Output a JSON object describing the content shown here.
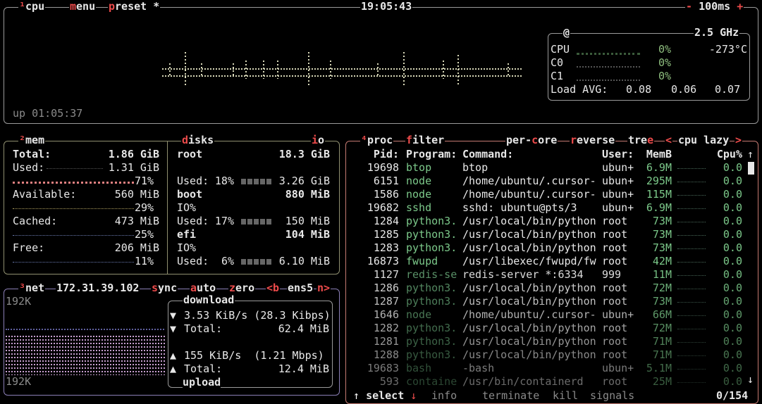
{
  "cpu": {
    "title": "cpu",
    "menu": "menu",
    "preset": "preset *",
    "clock": "19:05:43",
    "interval_minus": "-",
    "interval": "100ms",
    "interval_plus": "+",
    "uptime": "up 01:05:37",
    "freq_at": "@",
    "freq": "2.5 GHz",
    "rows": [
      {
        "label": "CPU",
        "pct": "0%",
        "temp": "-273°C"
      },
      {
        "label": "C0",
        "pct": "0%",
        "temp": ""
      },
      {
        "label": "C1",
        "pct": "0%",
        "temp": ""
      }
    ],
    "load_label": "Load AVG:",
    "load": [
      "0.08",
      "0.06",
      "0.07"
    ]
  },
  "mem": {
    "title": "mem",
    "total_label": "Total:",
    "total": "1.86 GiB",
    "used_label": "Used:",
    "used": "1.31 GiB",
    "used_pct": "71%",
    "avail_label": "Available:",
    "avail": "560 MiB",
    "avail_pct": "29%",
    "cached_label": "Cached:",
    "cached": "473 MiB",
    "cached_pct": "25%",
    "free_label": "Free:",
    "free": "206 MiB",
    "free_pct": "11%"
  },
  "disks": {
    "title": "disks",
    "io_tab": "io",
    "items": [
      {
        "name": "root",
        "size": "18.3 GiB",
        "io": "",
        "used_label": "Used:",
        "used_pct": "18%",
        "used": "3.26 GiB"
      },
      {
        "name": "boot",
        "size": "880 MiB",
        "io": "IO%",
        "used_label": "Used:",
        "used_pct": "17%",
        "used": "150 MiB"
      },
      {
        "name": "efi",
        "size": "104 MiB",
        "io": "IO%",
        "used_label": "Used:",
        "used_pct": "6%",
        "used": "6.10 MiB"
      }
    ]
  },
  "net": {
    "title": "net",
    "ip": "172.31.39.102",
    "sync": "sync",
    "auto": "auto",
    "zero": "zero",
    "prev": "<b",
    "iface": "ens5",
    "next": "n>",
    "scale_top": "192K",
    "scale_bottom": "192K",
    "download_label": "download",
    "down_rate": "3.53 KiB/s (28.3 Kibps)",
    "down_total_label": "Total:",
    "down_total": "62.4 MiB",
    "up_rate": "155 KiB/s  (1.21 Mbps)",
    "up_total_label": "Total:",
    "up_total": "12.4 MiB",
    "upload_label": "upload"
  },
  "proc": {
    "title": "proc",
    "filter": "filter",
    "per_core": "per-core",
    "reverse": "reverse",
    "tree": "tree",
    "sort": "cpu lazy",
    "sort_prev": "<",
    "sort_next": ">",
    "headers": {
      "pid": "Pid:",
      "program": "Program:",
      "command": "Command:",
      "user": "User:",
      "mem": "MemB",
      "cpu": "Cpu%"
    },
    "rows": [
      {
        "pid": "19698",
        "program": "btop",
        "command": "btop",
        "user": "ubun+",
        "mem": "6.9M",
        "cpu": "0.0"
      },
      {
        "pid": "6151",
        "program": "node",
        "command": "/home/ubuntu/.cursor-",
        "user": "ubun+",
        "mem": "295M",
        "cpu": "0.0"
      },
      {
        "pid": "1586",
        "program": "node",
        "command": "/home/ubuntu/.cursor-",
        "user": "ubun+",
        "mem": "115M",
        "cpu": "0.0"
      },
      {
        "pid": "19682",
        "program": "sshd",
        "command": "sshd: ubuntu@pts/3",
        "user": "ubun+",
        "mem": "6.9M",
        "cpu": "0.0"
      },
      {
        "pid": "1284",
        "program": "python3.",
        "command": "/usr/local/bin/python",
        "user": "root",
        "mem": "73M",
        "cpu": "0.0"
      },
      {
        "pid": "1285",
        "program": "python3.",
        "command": "/usr/local/bin/python",
        "user": "root",
        "mem": "73M",
        "cpu": "0.0"
      },
      {
        "pid": "1283",
        "program": "python3.",
        "command": "/usr/local/bin/python",
        "user": "root",
        "mem": "73M",
        "cpu": "0.0"
      },
      {
        "pid": "16873",
        "program": "fwupd",
        "command": "/usr/libexec/fwupd/fw",
        "user": "root",
        "mem": "42M",
        "cpu": "0.0"
      },
      {
        "pid": "1127",
        "program": "redis-se",
        "command": "redis-server *:6334",
        "user": "999",
        "mem": "11M",
        "cpu": "0.0"
      },
      {
        "pid": "1286",
        "program": "python3.",
        "command": "/usr/local/bin/python",
        "user": "root",
        "mem": "72M",
        "cpu": "0.0"
      },
      {
        "pid": "1287",
        "program": "python3.",
        "command": "/usr/local/bin/python",
        "user": "root",
        "mem": "73M",
        "cpu": "0.0"
      },
      {
        "pid": "1646",
        "program": "node",
        "command": "/home/ubuntu/.cursor-",
        "user": "ubun+",
        "mem": "66M",
        "cpu": "0.0"
      },
      {
        "pid": "1282",
        "program": "python3.",
        "command": "/usr/local/bin/python",
        "user": "root",
        "mem": "72M",
        "cpu": "0.0"
      },
      {
        "pid": "1281",
        "program": "python3.",
        "command": "/usr/local/bin/python",
        "user": "root",
        "mem": "71M",
        "cpu": "0.0"
      },
      {
        "pid": "1288",
        "program": "python3.",
        "command": "/usr/local/bin/python",
        "user": "root",
        "mem": "71M",
        "cpu": "0.0"
      },
      {
        "pid": "19683",
        "program": "bash",
        "command": "-bash",
        "user": "ubun+",
        "mem": "5.1M",
        "cpu": "0.0"
      },
      {
        "pid": "593",
        "program": "containe",
        "command": "/usr/bin/containerd",
        "user": "root",
        "mem": "25M",
        "cpu": "0.0"
      }
    ],
    "footer_select": "select",
    "footer_info": "info",
    "footer_terminate": "terminate",
    "footer_kill": "kill",
    "footer_signals": "signals",
    "count": "0/154"
  },
  "colors": {
    "cpu_border": "#9a9a9a",
    "mem_border": "#8f8f70",
    "net_border": "#8b7fb6",
    "proc_border": "#c57a72",
    "accent": "#ee4b4b"
  }
}
